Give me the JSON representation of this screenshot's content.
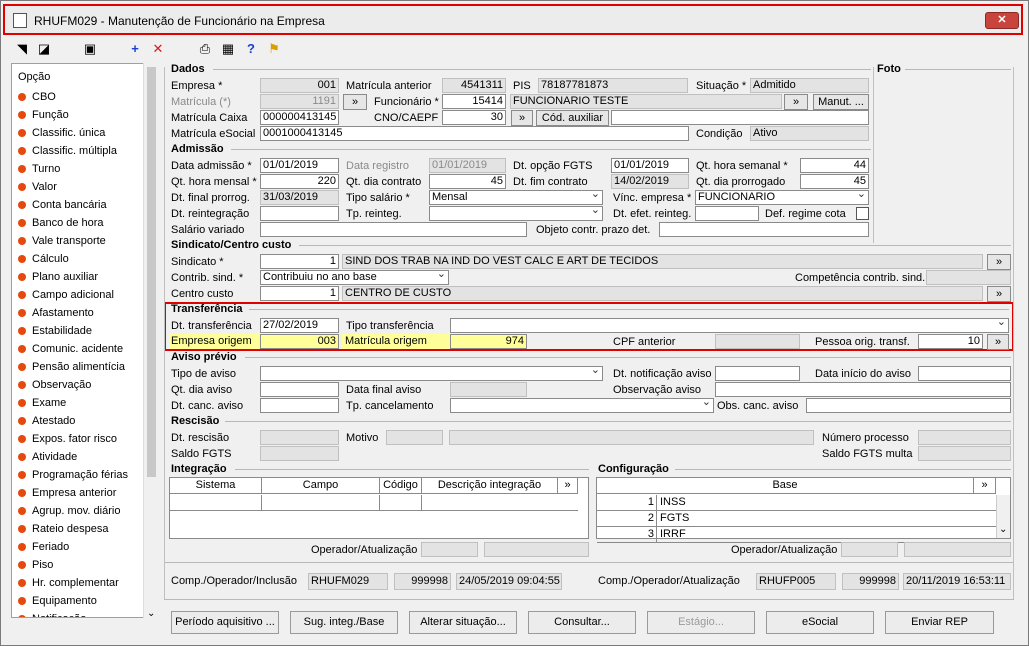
{
  "window": {
    "title": "RHUFM029 - Manutenção de Funcionário na Empresa",
    "close": "✕"
  },
  "toolbar": {
    "icons": [
      "first-icon",
      "nav-icon",
      "save-icon",
      "add-icon",
      "delete-icon",
      "print-icon",
      "calc-icon",
      "help-icon",
      "exit-icon"
    ],
    "add": "+",
    "del": "✕",
    "help": "?"
  },
  "sidebar": {
    "title": "Opção",
    "items": [
      "CBO",
      "Função",
      "Classific. única",
      "Classific. múltipla",
      "Turno",
      "Valor",
      "Conta bancária",
      "Banco de hora",
      "Vale transporte",
      "Cálculo",
      "Plano auxiliar",
      "Campo adicional",
      "Afastamento",
      "Estabilidade",
      "Comunic. acidente",
      "Pensão alimentícia",
      "Observação",
      "Exame",
      "Atestado",
      "Expos. fator risco",
      "Atividade",
      "Programação férias",
      "Empresa anterior",
      "Agrup. mov. diário",
      "Rateio despesa",
      "Feriado",
      "Piso",
      "Hr. complementar",
      "Equipamento",
      "Notificação"
    ]
  },
  "dados": {
    "section": "Dados",
    "foto": "Foto",
    "empresa_lbl": "Empresa *",
    "empresa": "001",
    "mat_ant_lbl": "Matrícula anterior",
    "mat_ant": "4541311",
    "pis_lbl": "PIS",
    "pis": "78187781873",
    "situacao_lbl": "Situação *",
    "situacao": "Admitido",
    "matricula_lbl": "Matrícula (*)",
    "matricula": "1191",
    "arrow": "»",
    "func_lbl": "Funcionário *",
    "func_num": "15414",
    "func_nome": "FUNCIONARIO TESTE",
    "manut": "Manut. ...",
    "mat_caixa_lbl": "Matrícula Caixa",
    "mat_caixa": "000000413145",
    "cno_lbl": "CNO/CAEPF",
    "cno": "30",
    "cod_aux": "Cód. auxiliar",
    "mat_esocial_lbl": "Matrícula eSocial",
    "mat_esocial": "0001000413145",
    "condicao_lbl": "Condição",
    "condicao": "Ativo"
  },
  "admissao": {
    "section": "Admissão",
    "dt_adm_lbl": "Data admissão *",
    "dt_adm": "01/01/2019",
    "dt_reg_lbl": "Data registro",
    "dt_reg": "01/01/2019",
    "dt_fgts_lbl": "Dt. opção FGTS",
    "dt_fgts": "01/01/2019",
    "qt_sem_lbl": "Qt. hora semanal *",
    "qt_sem": "44",
    "qt_mens_lbl": "Qt. hora mensal *",
    "qt_mens": "220",
    "qt_dia_lbl": "Qt. dia contrato",
    "qt_dia": "45",
    "dt_fim_lbl": "Dt. fim contrato",
    "dt_fim": "14/02/2019",
    "qt_prorr_lbl": "Qt. dia prorrogado",
    "qt_prorr": "45",
    "dt_final_lbl": "Dt. final prorrog.",
    "dt_final": "31/03/2019",
    "tipo_sal_lbl": "Tipo salário *",
    "tipo_sal": "Mensal",
    "vinc_lbl": "Vínc. empresa *",
    "vinc": "FUNCIONARIO",
    "dt_reint_lbl": "Dt. reintegração",
    "tp_reint_lbl": "Tp. reinteg.",
    "dt_efet_lbl": "Dt. efet. reinteg.",
    "def_lbl": "Def. regime cota",
    "sal_var_lbl": "Salário variado",
    "obj_lbl": "Objeto contr. prazo det."
  },
  "sindicato": {
    "section": "Sindicato/Centro custo",
    "sind_lbl": "Sindicato *",
    "sind_num": "1",
    "sind_nome": "SIND DOS TRAB NA IND DO VEST CALC E ART DE TECIDOS",
    "contrib_lbl": "Contrib. sind. *",
    "contrib": "Contribuiu no ano base",
    "comp_lbl": "Competência contrib. sind.",
    "cc_lbl": "Centro custo",
    "cc_num": "1",
    "cc_nome": "CENTRO DE CUSTO"
  },
  "transf": {
    "section": "Transferência",
    "dt_lbl": "Dt. transferência",
    "dt": "27/02/2019",
    "tipo_lbl": "Tipo transferência",
    "emp_orig_lbl": "Empresa origem",
    "emp_orig": "003",
    "mat_orig_lbl": "Matrícula origem",
    "mat_orig": "974",
    "cpf_lbl": "CPF anterior",
    "pessoa_lbl": "Pessoa orig. transf.",
    "pessoa": "10"
  },
  "aviso": {
    "section": "Aviso prévio",
    "tipo_lbl": "Tipo de aviso",
    "dt_notif_lbl": "Dt. notificação aviso",
    "dt_ini_lbl": "Data início do aviso",
    "qt_dia_lbl": "Qt. dia aviso",
    "dt_final_lbl": "Data final aviso",
    "obs_lbl": "Observação aviso",
    "dt_canc_lbl": "Dt. canc. aviso",
    "tp_canc_lbl": "Tp. cancelamento",
    "obs_canc_lbl": "Obs. canc. aviso"
  },
  "rescisao": {
    "section": "Rescisão",
    "dt_lbl": "Dt. rescisão",
    "motivo_lbl": "Motivo",
    "num_proc_lbl": "Número processo",
    "saldo_lbl": "Saldo FGTS",
    "saldo_multa_lbl": "Saldo FGTS multa"
  },
  "integracao": {
    "section": "Integração",
    "cols": [
      "Sistema",
      "Campo",
      "Código",
      "Descrição integração"
    ],
    "op_lbl": "Operador/Atualização"
  },
  "configuracao": {
    "section": "Configuração",
    "col": "Base",
    "rows": [
      {
        "n": "1",
        "base": "INSS"
      },
      {
        "n": "2",
        "base": "FGTS"
      },
      {
        "n": "3",
        "base": "IRRF"
      }
    ],
    "op_lbl": "Operador/Atualização"
  },
  "footer": {
    "inc_lbl": "Comp./Operador/Inclusão",
    "inc_comp": "RHUFM029",
    "inc_op": "999998",
    "inc_dt": "24/05/2019 09:04:55",
    "at_lbl": "Comp./Operador/Atualização",
    "at_comp": "RHUFP005",
    "at_op": "999998",
    "at_dt": "20/11/2019 16:53:11"
  },
  "buttons": [
    "Período aquisitivo ...",
    "Sug. integ./Base",
    "Alterar situação...",
    "Consultar...",
    "Estágio...",
    "eSocial",
    "Enviar REP"
  ]
}
